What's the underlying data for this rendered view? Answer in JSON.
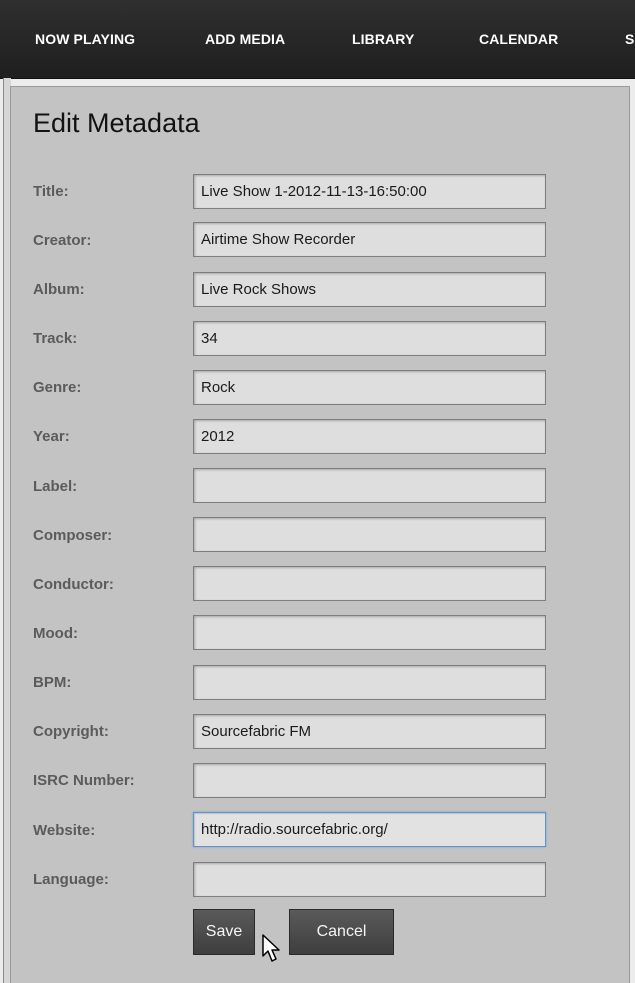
{
  "nav": {
    "items": [
      {
        "label": "NOW PLAYING"
      },
      {
        "label": "ADD MEDIA"
      },
      {
        "label": "LIBRARY"
      },
      {
        "label": "CALENDAR"
      },
      {
        "label": "S"
      }
    ]
  },
  "form": {
    "title": "Edit Metadata",
    "fields": [
      {
        "label": "Title:",
        "value": "Live Show 1-2012-11-13-16:50:00"
      },
      {
        "label": "Creator:",
        "value": "Airtime Show Recorder"
      },
      {
        "label": "Album:",
        "value": "Live Rock Shows"
      },
      {
        "label": "Track:",
        "value": "34"
      },
      {
        "label": "Genre:",
        "value": "Rock"
      },
      {
        "label": "Year:",
        "value": "2012"
      },
      {
        "label": "Label:",
        "value": ""
      },
      {
        "label": "Composer:",
        "value": ""
      },
      {
        "label": "Conductor:",
        "value": ""
      },
      {
        "label": "Mood:",
        "value": ""
      },
      {
        "label": "BPM:",
        "value": ""
      },
      {
        "label": "Copyright:",
        "value": "Sourcefabric FM"
      },
      {
        "label": "ISRC Number:",
        "value": ""
      },
      {
        "label": "Website:",
        "value": "http://radio.sourcefabric.org/"
      },
      {
        "label": "Language:",
        "value": ""
      }
    ],
    "save_label": "Save",
    "cancel_label": "Cancel"
  },
  "colors": {
    "nav_bg": "#262626",
    "panel_bg": "#c3c3c3",
    "label_text": "#5b5b5b",
    "button_bg": "#4a4a4a",
    "focus_border": "#5f93c9"
  }
}
